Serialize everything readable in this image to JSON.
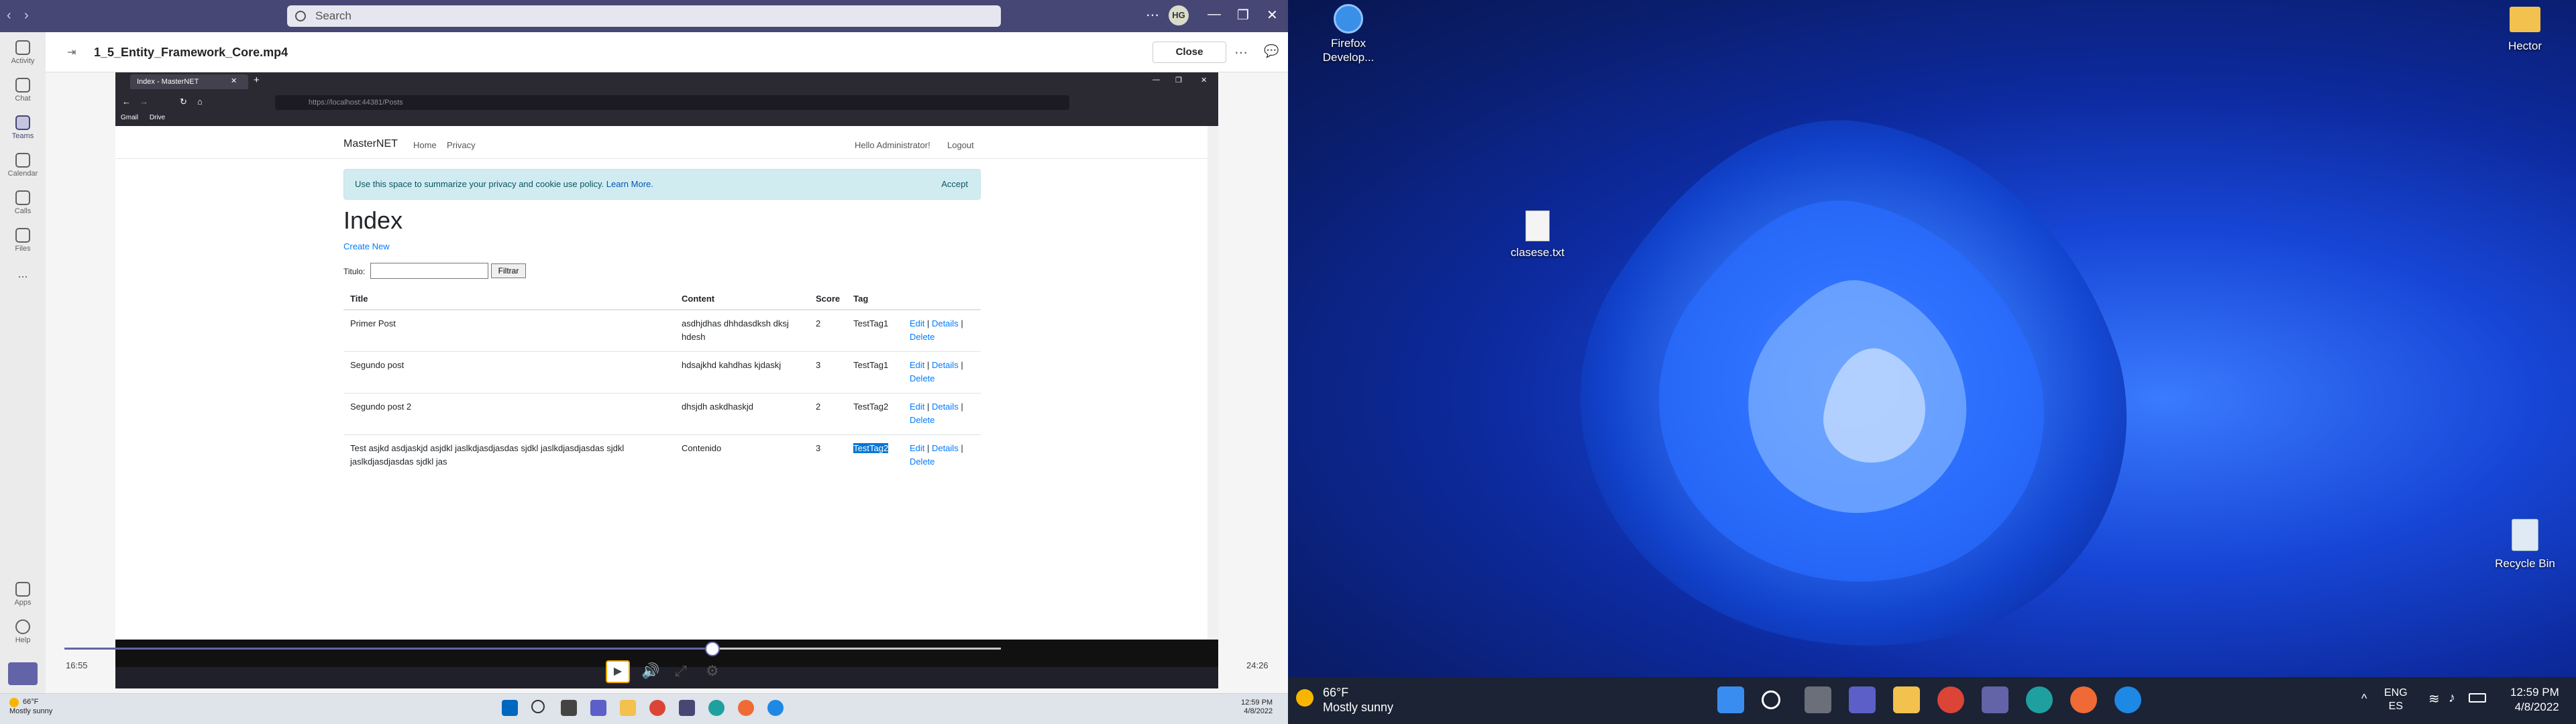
{
  "teams": {
    "search_placeholder": "Search",
    "avatar_initials": "HG",
    "rail": [
      {
        "label": "Activity",
        "icon": "bell-icon"
      },
      {
        "label": "Chat",
        "icon": "chat-icon"
      },
      {
        "label": "Teams",
        "icon": "teams-icon"
      },
      {
        "label": "Calendar",
        "icon": "calendar-icon"
      },
      {
        "label": "Calls",
        "icon": "phone-icon"
      },
      {
        "label": "Files",
        "icon": "file-icon"
      },
      {
        "label": "...",
        "icon": "more-icon"
      },
      {
        "label": "Apps",
        "icon": "apps-icon"
      },
      {
        "label": "Help",
        "icon": "help-icon"
      }
    ],
    "file_title": "1_5_Entity_Framework_Core.mp4",
    "close_label": "Close"
  },
  "browser": {
    "tab_title": "Index - MasterNET",
    "url": "https://localhost:44381/Posts",
    "bookmarks": [
      "Gmail",
      "Drive"
    ]
  },
  "web": {
    "brand": "MasterNET",
    "nav": [
      "Home",
      "Privacy"
    ],
    "greeting": "Hello Administrator!",
    "logout": "Logout",
    "cookie_text": "Use this space to summarize your privacy and cookie use policy.",
    "cookie_link": "Learn More.",
    "accept": "Accept",
    "heading": "Index",
    "create_new": "Create New",
    "filter_label": "Titulo:",
    "filter_button": "Filtrar",
    "columns": [
      "Title",
      "Content",
      "Score",
      "Tag"
    ],
    "rows": [
      {
        "title": "Primer Post",
        "content": "asdhjdhas dhhdasdksh dksj hdesh",
        "score": "2",
        "tag": "TestTag1"
      },
      {
        "title": "Segundo post",
        "content": "hdsajkhd kahdhas kjdaskj",
        "score": "3",
        "tag": "TestTag1"
      },
      {
        "title": "Segundo post 2",
        "content": "dhsjdh askdhaskjd",
        "score": "2",
        "tag": "TestTag2"
      },
      {
        "title": "Test asjkd asdjaskjd asjdkl jaslkdjasdjasdas sjdkl jaslkdjasdjasdas sjdkl jaslkdjasdjasdas sjdkl jas",
        "content": "Contenido",
        "score": "3",
        "tag": "TestTag2"
      }
    ],
    "actions": [
      "Edit",
      "Details",
      "Delete"
    ]
  },
  "player": {
    "current_time": "16:55",
    "duration": "24:26",
    "progress": 0.692
  },
  "taskbar_left": {
    "temp": "66°F",
    "weather": "Mostly sunny",
    "time": "12:59 PM",
    "date": "4/8/2022"
  },
  "desktop": {
    "icons": [
      "Firefox Develop...",
      "Hector",
      "clasese.txt",
      "Recycle Bin"
    ]
  },
  "taskbar_right": {
    "temp": "66°F",
    "weather": "Mostly sunny",
    "lang1": "ENG",
    "lang2": "ES",
    "time": "12:59 PM",
    "date": "4/8/2022"
  },
  "colors": {
    "teams_purple": "#464775",
    "link_blue": "#007bff",
    "selection_blue": "#0078d7",
    "wallpaper_blue": "#1746d6"
  }
}
